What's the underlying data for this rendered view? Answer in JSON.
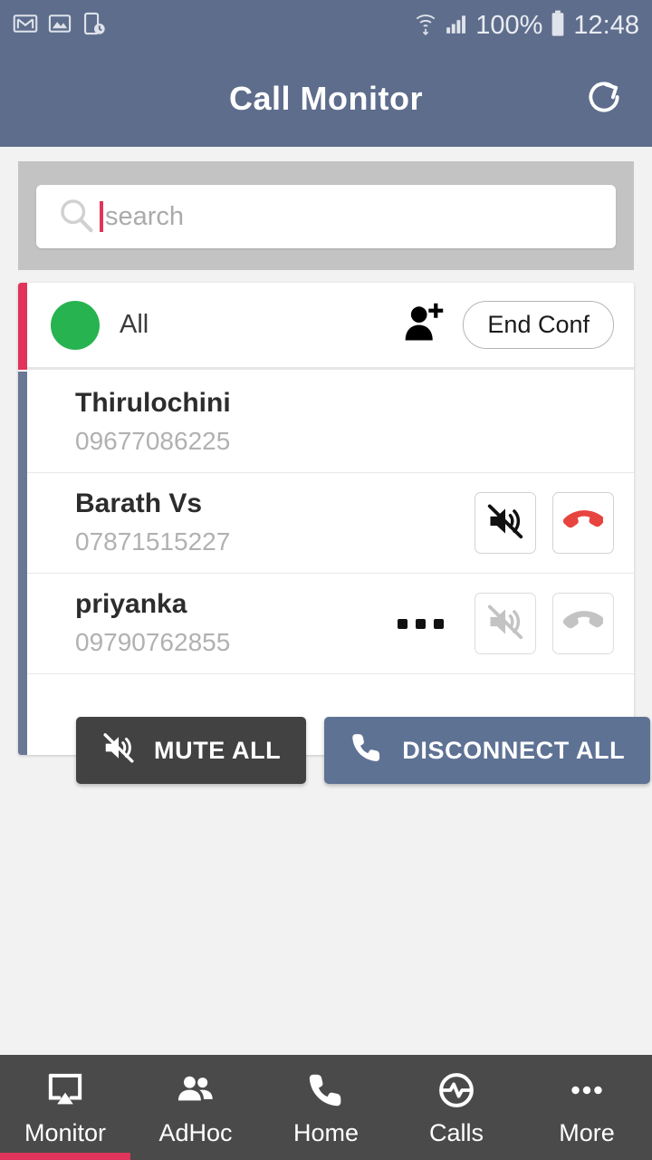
{
  "status_bar": {
    "time": "12:48",
    "battery_percent": "100%",
    "left_icons": [
      "gmail-icon",
      "photo-icon",
      "device-clock-icon"
    ],
    "right_icons": [
      "wifi-icon",
      "signal-icon",
      "battery-icon"
    ]
  },
  "app_bar": {
    "title": "Call Monitor",
    "refresh_label": "refresh-icon",
    "background": "#5e6d8c"
  },
  "search": {
    "placeholder": "search",
    "value": "",
    "icon": "search-icon",
    "caret_color": "#e0345a"
  },
  "conference": {
    "status_color": "#27b34f",
    "label": "All",
    "add_participant_icon": "person-add-icon",
    "end_conf_label": "End Conf",
    "accent_top": "#e0345a",
    "accent_body": "#6a7794",
    "participants": [
      {
        "name": "Thirulochini",
        "number": "09677086225",
        "has_actions": false,
        "has_ellipsis": false,
        "mute_enabled": false,
        "hangup_enabled": false
      },
      {
        "name": "Barath Vs",
        "number": "07871515227",
        "has_actions": true,
        "has_ellipsis": false,
        "mute_enabled": true,
        "hangup_enabled": true
      },
      {
        "name": "priyanka",
        "number": "09790762855",
        "has_actions": true,
        "has_ellipsis": true,
        "mute_enabled": false,
        "hangup_enabled": false
      }
    ]
  },
  "bulk_actions": {
    "mute_all_label": "MUTE ALL",
    "mute_all_color": "#424242",
    "disconnect_all_label": "DISCONNECT ALL",
    "disconnect_all_color": "#5e7294"
  },
  "bottom_nav": {
    "active_index": 0,
    "active_color": "#e0345a",
    "items": [
      {
        "label": "Monitor",
        "icon": "cast-screen-icon"
      },
      {
        "label": "AdHoc",
        "icon": "people-icon"
      },
      {
        "label": "Home",
        "icon": "phone-icon"
      },
      {
        "label": "Calls",
        "icon": "pulse-circle-icon"
      },
      {
        "label": "More",
        "icon": "more-dots-icon"
      }
    ]
  }
}
